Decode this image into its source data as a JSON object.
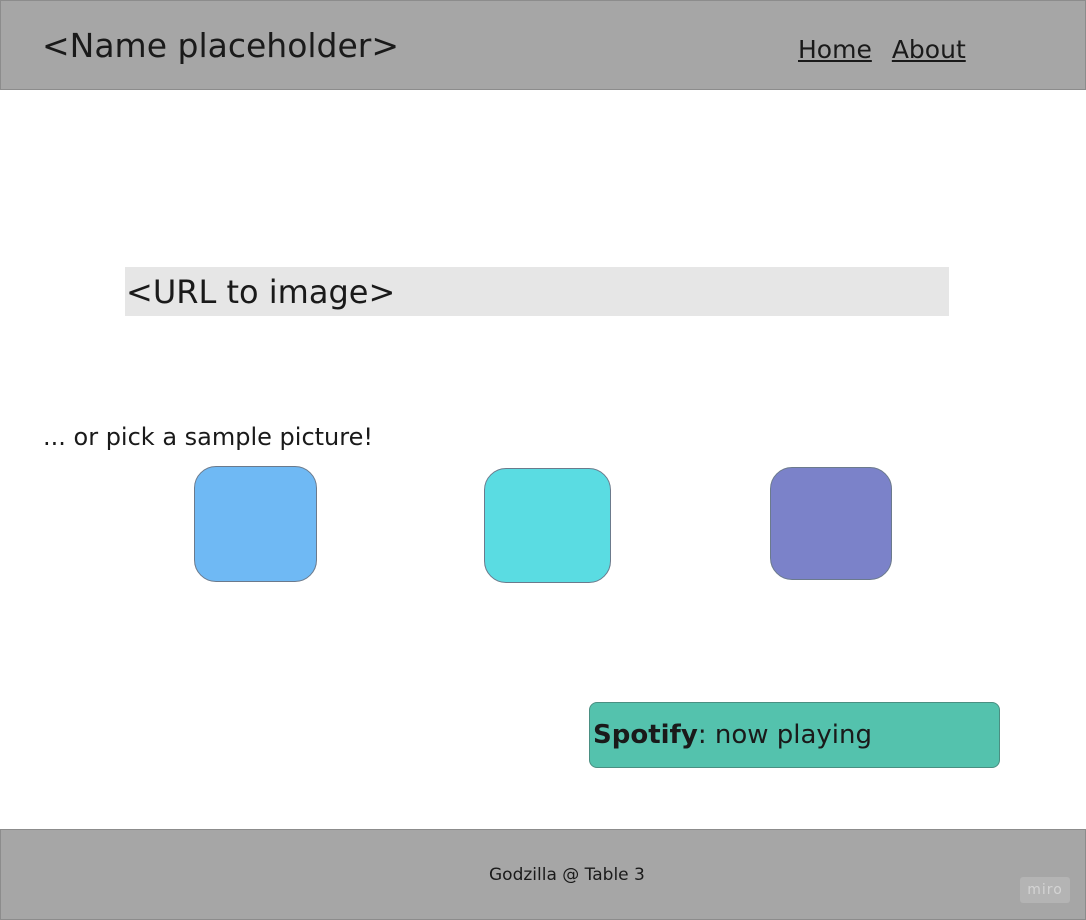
{
  "header": {
    "title": "<Name placeholder>",
    "nav": [
      {
        "label": "Home"
      },
      {
        "label": "About"
      }
    ]
  },
  "main": {
    "url_input": {
      "placeholder": "<URL to image>",
      "value": ""
    },
    "pick_label": "... or pick a sample picture!",
    "samples": [
      {
        "color": "#6fb9f4"
      },
      {
        "color": "#5adce2"
      },
      {
        "color": "#7b82c9"
      }
    ]
  },
  "spotify": {
    "brand": "Spotify",
    "status": ": now playing",
    "color": "#54c2ad"
  },
  "footer": {
    "text": "Godzilla @ Table 3",
    "watermark": "miro"
  }
}
